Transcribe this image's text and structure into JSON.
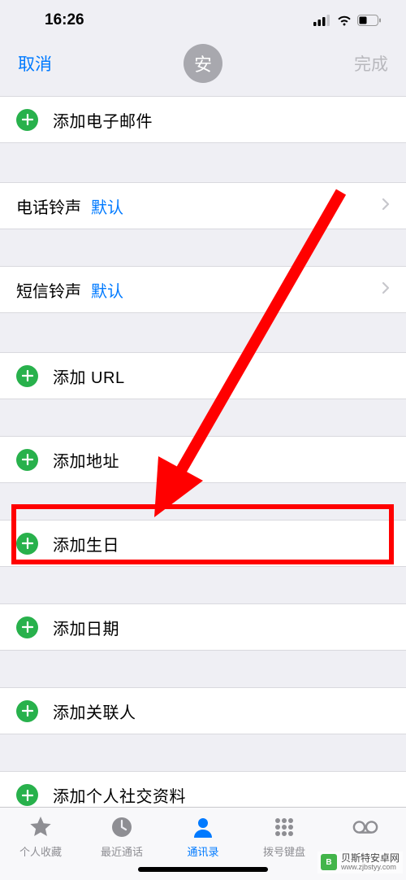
{
  "status": {
    "time": "16:26"
  },
  "nav": {
    "cancel": "取消",
    "done": "完成"
  },
  "avatar": {
    "initial": "安"
  },
  "rows": {
    "add_email": "添加电子邮件",
    "ringtone_label": "电话铃声",
    "ringtone_value": "默认",
    "sms_label": "短信铃声",
    "sms_value": "默认",
    "add_url": "添加 URL",
    "add_address": "添加地址",
    "add_birthday": "添加生日",
    "add_date": "添加日期",
    "add_related": "添加关联人",
    "add_social": "添加个人社交资料"
  },
  "tabs": {
    "favorites": "个人收藏",
    "recents": "最近通话",
    "contacts": "通讯录",
    "keypad": "拨号键盘",
    "voicemail": ""
  },
  "watermark": {
    "name": "贝斯特安卓网",
    "url": "www.zjbstyy.com"
  }
}
